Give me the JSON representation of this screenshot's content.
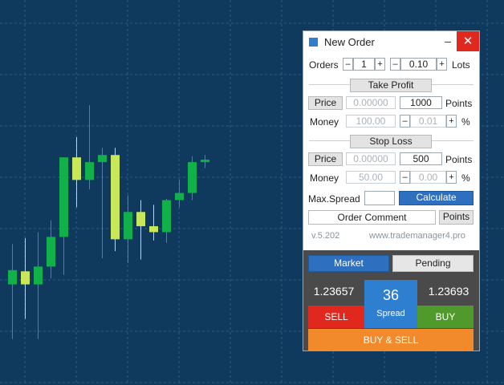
{
  "colors": {
    "background": "#0f3a5e",
    "grid": "#2a5f8a",
    "bull": "#12b04a",
    "bear": "#c8e85a",
    "sell": "#e0281e",
    "buy": "#4f9a2a",
    "buy_sell": "#f28a2c",
    "accent": "#2f6fbf",
    "spread": "#2f7fd0"
  },
  "chart_data": {
    "type": "candlestick",
    "candles": [
      {
        "o": 1.2338,
        "h": 1.2372,
        "l": 1.2292,
        "c": 1.235
      },
      {
        "o": 1.2349,
        "h": 1.2377,
        "l": 1.2309,
        "c": 1.2338
      },
      {
        "o": 1.2338,
        "h": 1.2382,
        "l": 1.2292,
        "c": 1.2353
      },
      {
        "o": 1.2353,
        "h": 1.2392,
        "l": 1.2343,
        "c": 1.2378
      },
      {
        "o": 1.2378,
        "h": 1.2429,
        "l": 1.2346,
        "c": 1.2445
      },
      {
        "o": 1.2445,
        "h": 1.2462,
        "l": 1.2403,
        "c": 1.2426
      },
      {
        "o": 1.2426,
        "h": 1.2489,
        "l": 1.2418,
        "c": 1.2441
      },
      {
        "o": 1.2441,
        "h": 1.2453,
        "l": 1.236,
        "c": 1.2447
      },
      {
        "o": 1.2447,
        "h": 1.2453,
        "l": 1.2366,
        "c": 1.2376
      },
      {
        "o": 1.2376,
        "h": 1.2413,
        "l": 1.2356,
        "c": 1.2399
      },
      {
        "o": 1.2399,
        "h": 1.2409,
        "l": 1.2359,
        "c": 1.2387
      },
      {
        "o": 1.2387,
        "h": 1.2405,
        "l": 1.2375,
        "c": 1.2382
      },
      {
        "o": 1.2382,
        "h": 1.241,
        "l": 1.2373,
        "c": 1.2409
      },
      {
        "o": 1.2409,
        "h": 1.2426,
        "l": 1.2403,
        "c": 1.2415
      },
      {
        "o": 1.2415,
        "h": 1.2446,
        "l": 1.2409,
        "c": 1.2441
      },
      {
        "o": 1.2441,
        "h": 1.2447,
        "l": 1.2436,
        "c": 1.2443
      }
    ]
  },
  "window": {
    "title": "New Order",
    "minimize": "–",
    "close": "✕"
  },
  "orders": {
    "label": "Orders",
    "count": "1",
    "lots_value": "0.10",
    "lots_label": "Lots",
    "minus": "–",
    "plus": "+"
  },
  "take_profit": {
    "header": "Take Profit",
    "price_label": "Price",
    "price_value": "0.00000",
    "points_value": "1000",
    "points_label": "Points",
    "money_label": "Money",
    "money_value": "100.00",
    "percent_value": "0.01",
    "percent_label": "%",
    "minus": "–",
    "plus": "+"
  },
  "stop_loss": {
    "header": "Stop Loss",
    "price_label": "Price",
    "price_value": "0.00000",
    "points_value": "500",
    "points_label": "Points",
    "money_label": "Money",
    "money_value": "50.00",
    "percent_value": "0.00",
    "percent_label": "%",
    "minus": "–",
    "plus": "+"
  },
  "max_spread": {
    "label": "Max.Spread",
    "value": "",
    "calculate": "Calculate"
  },
  "comment": {
    "order_comment": "Order Comment",
    "points": "Points"
  },
  "footer": {
    "version": "v.5.202",
    "website": "www.trademanager4.pro"
  },
  "trade": {
    "tab_market": "Market",
    "tab_pending": "Pending",
    "bid": "1.23657",
    "ask": "1.23693",
    "spread_value": "36",
    "spread_label": "Spread",
    "sell": "SELL",
    "buy": "BUY",
    "buy_sell": "BUY & SELL"
  }
}
